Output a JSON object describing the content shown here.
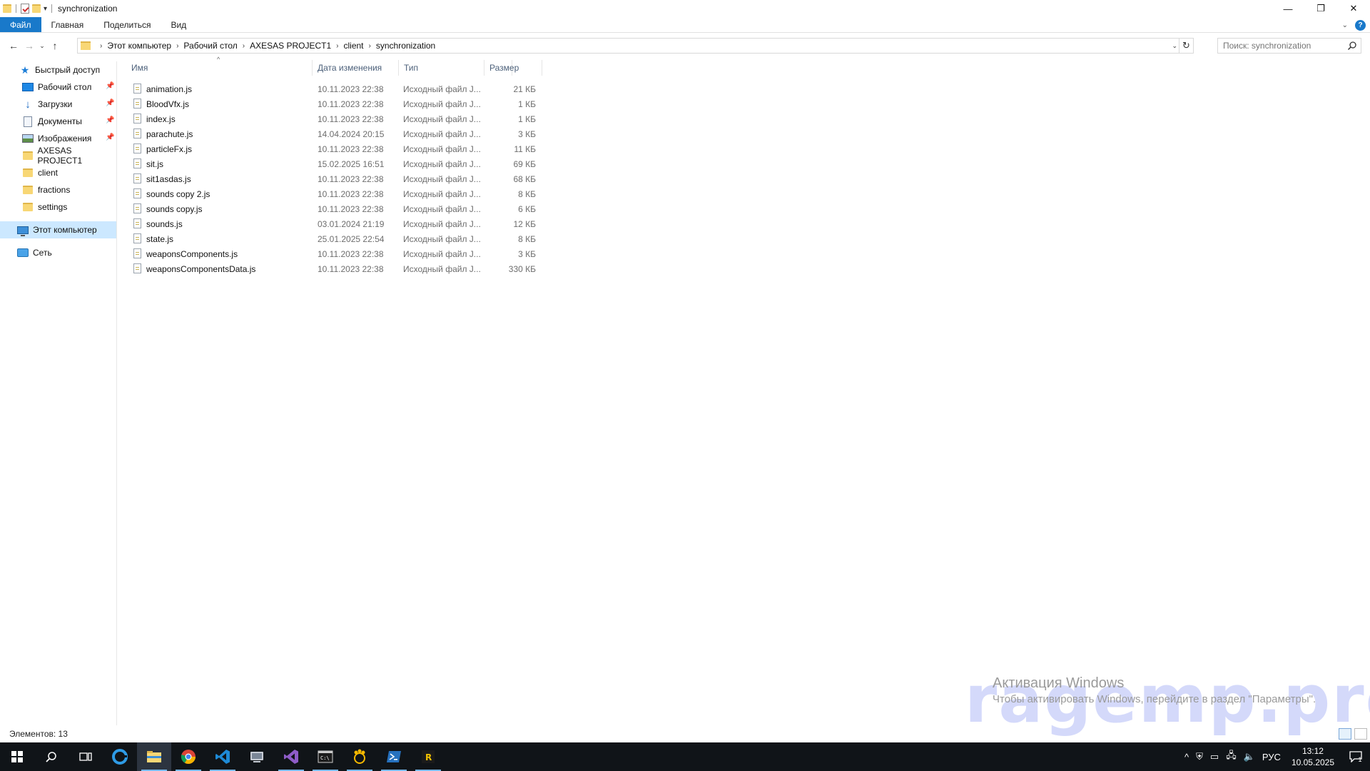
{
  "window": {
    "title": "synchronization",
    "controls": {
      "minimize": "—",
      "restore": "❐",
      "close": "✕"
    }
  },
  "ribbon": {
    "tabs": [
      {
        "label": "Файл"
      },
      {
        "label": "Главная"
      },
      {
        "label": "Поделиться"
      },
      {
        "label": "Вид"
      }
    ],
    "help_label": "?"
  },
  "address": {
    "crumbs": [
      "Этот компьютер",
      "Рабочий стол",
      "AXESAS PROJECT1",
      "client",
      "synchronization"
    ]
  },
  "search": {
    "placeholder": "Поиск: synchronization"
  },
  "nav": {
    "quick_access": "Быстрый доступ",
    "items": [
      {
        "label": "Рабочий стол",
        "icon": "desktop-icon",
        "pinned": true
      },
      {
        "label": "Загрузки",
        "icon": "download-icon",
        "pinned": true
      },
      {
        "label": "Документы",
        "icon": "documents-icon",
        "pinned": true
      },
      {
        "label": "Изображения",
        "icon": "pictures-icon",
        "pinned": true
      },
      {
        "label": "AXESAS PROJECT1",
        "icon": "folder-icon",
        "pinned": false
      },
      {
        "label": "client",
        "icon": "folder-icon",
        "pinned": false
      },
      {
        "label": "fractions",
        "icon": "folder-icon",
        "pinned": false
      },
      {
        "label": "settings",
        "icon": "folder-icon",
        "pinned": false
      }
    ],
    "this_pc": "Этот компьютер",
    "network": "Сеть"
  },
  "columns": {
    "name": "Имя",
    "date": "Дата изменения",
    "type": "Тип",
    "size": "Размер"
  },
  "files": [
    {
      "name": "animation.js",
      "date": "10.11.2023 22:38",
      "type": "Исходный файл J...",
      "size": "21 КБ"
    },
    {
      "name": "BloodVfx.js",
      "date": "10.11.2023 22:38",
      "type": "Исходный файл J...",
      "size": "1 КБ"
    },
    {
      "name": "index.js",
      "date": "10.11.2023 22:38",
      "type": "Исходный файл J...",
      "size": "1 КБ"
    },
    {
      "name": "parachute.js",
      "date": "14.04.2024 20:15",
      "type": "Исходный файл J...",
      "size": "3 КБ"
    },
    {
      "name": "particleFx.js",
      "date": "10.11.2023 22:38",
      "type": "Исходный файл J...",
      "size": "11 КБ"
    },
    {
      "name": "sit.js",
      "date": "15.02.2025 16:51",
      "type": "Исходный файл J...",
      "size": "69 КБ"
    },
    {
      "name": "sit1asdas.js",
      "date": "10.11.2023 22:38",
      "type": "Исходный файл J...",
      "size": "68 КБ"
    },
    {
      "name": "sounds copy 2.js",
      "date": "10.11.2023 22:38",
      "type": "Исходный файл J...",
      "size": "8 КБ"
    },
    {
      "name": "sounds copy.js",
      "date": "10.11.2023 22:38",
      "type": "Исходный файл J...",
      "size": "6 КБ"
    },
    {
      "name": "sounds.js",
      "date": "03.01.2024 21:19",
      "type": "Исходный файл J...",
      "size": "12 КБ"
    },
    {
      "name": "state.js",
      "date": "25.01.2025 22:54",
      "type": "Исходный файл J...",
      "size": "8 КБ"
    },
    {
      "name": "weaponsComponents.js",
      "date": "10.11.2023 22:38",
      "type": "Исходный файл J...",
      "size": "3 КБ"
    },
    {
      "name": "weaponsComponentsData.js",
      "date": "10.11.2023 22:38",
      "type": "Исходный файл J...",
      "size": "330 КБ"
    }
  ],
  "status": {
    "items_count": "Элементов: 13"
  },
  "watermark": {
    "activation_title": "Активация Windows",
    "activation_text": "Чтобы активировать Windows, перейдите в раздел \"Параметры\".",
    "site": "ragemp.pro"
  },
  "taskbar": {
    "apps": [
      "start-icon",
      "search-icon",
      "task-view-icon",
      "edge-icon",
      "file-explorer-icon",
      "chrome-icon",
      "vscode-icon",
      "app-icon",
      "visual-studio-icon",
      "terminal-icon",
      "game-client-icon",
      "powershell-icon",
      "rage-icon"
    ],
    "language": "РУС",
    "time": "13:12",
    "date": "10.05.2025",
    "notification_count": "1"
  },
  "colors": {
    "accent": "#1979ca",
    "selected_bg": "#cce8ff",
    "taskbar_bg": "#101418"
  }
}
